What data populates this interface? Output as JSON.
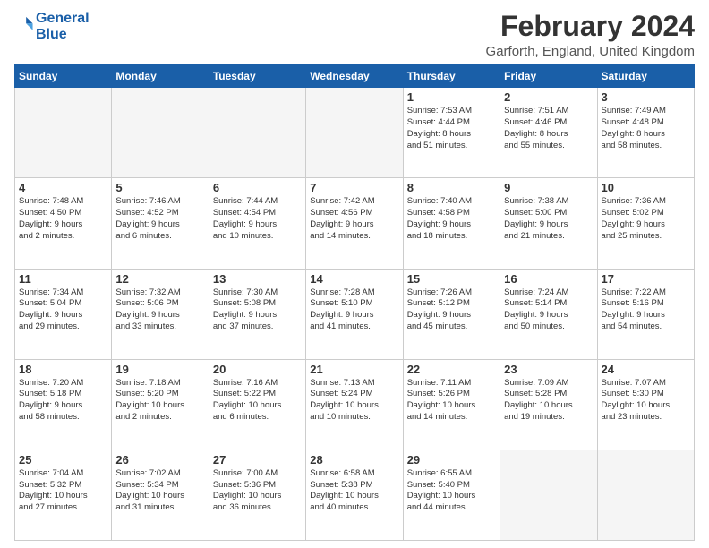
{
  "logo": {
    "line1": "General",
    "line2": "Blue"
  },
  "title": {
    "main": "February 2024",
    "sub": "Garforth, England, United Kingdom"
  },
  "days_of_week": [
    "Sunday",
    "Monday",
    "Tuesday",
    "Wednesday",
    "Thursday",
    "Friday",
    "Saturday"
  ],
  "weeks": [
    [
      {
        "day": "",
        "info": ""
      },
      {
        "day": "",
        "info": ""
      },
      {
        "day": "",
        "info": ""
      },
      {
        "day": "",
        "info": ""
      },
      {
        "day": "1",
        "info": "Sunrise: 7:53 AM\nSunset: 4:44 PM\nDaylight: 8 hours\nand 51 minutes."
      },
      {
        "day": "2",
        "info": "Sunrise: 7:51 AM\nSunset: 4:46 PM\nDaylight: 8 hours\nand 55 minutes."
      },
      {
        "day": "3",
        "info": "Sunrise: 7:49 AM\nSunset: 4:48 PM\nDaylight: 8 hours\nand 58 minutes."
      }
    ],
    [
      {
        "day": "4",
        "info": "Sunrise: 7:48 AM\nSunset: 4:50 PM\nDaylight: 9 hours\nand 2 minutes."
      },
      {
        "day": "5",
        "info": "Sunrise: 7:46 AM\nSunset: 4:52 PM\nDaylight: 9 hours\nand 6 minutes."
      },
      {
        "day": "6",
        "info": "Sunrise: 7:44 AM\nSunset: 4:54 PM\nDaylight: 9 hours\nand 10 minutes."
      },
      {
        "day": "7",
        "info": "Sunrise: 7:42 AM\nSunset: 4:56 PM\nDaylight: 9 hours\nand 14 minutes."
      },
      {
        "day": "8",
        "info": "Sunrise: 7:40 AM\nSunset: 4:58 PM\nDaylight: 9 hours\nand 18 minutes."
      },
      {
        "day": "9",
        "info": "Sunrise: 7:38 AM\nSunset: 5:00 PM\nDaylight: 9 hours\nand 21 minutes."
      },
      {
        "day": "10",
        "info": "Sunrise: 7:36 AM\nSunset: 5:02 PM\nDaylight: 9 hours\nand 25 minutes."
      }
    ],
    [
      {
        "day": "11",
        "info": "Sunrise: 7:34 AM\nSunset: 5:04 PM\nDaylight: 9 hours\nand 29 minutes."
      },
      {
        "day": "12",
        "info": "Sunrise: 7:32 AM\nSunset: 5:06 PM\nDaylight: 9 hours\nand 33 minutes."
      },
      {
        "day": "13",
        "info": "Sunrise: 7:30 AM\nSunset: 5:08 PM\nDaylight: 9 hours\nand 37 minutes."
      },
      {
        "day": "14",
        "info": "Sunrise: 7:28 AM\nSunset: 5:10 PM\nDaylight: 9 hours\nand 41 minutes."
      },
      {
        "day": "15",
        "info": "Sunrise: 7:26 AM\nSunset: 5:12 PM\nDaylight: 9 hours\nand 45 minutes."
      },
      {
        "day": "16",
        "info": "Sunrise: 7:24 AM\nSunset: 5:14 PM\nDaylight: 9 hours\nand 50 minutes."
      },
      {
        "day": "17",
        "info": "Sunrise: 7:22 AM\nSunset: 5:16 PM\nDaylight: 9 hours\nand 54 minutes."
      }
    ],
    [
      {
        "day": "18",
        "info": "Sunrise: 7:20 AM\nSunset: 5:18 PM\nDaylight: 9 hours\nand 58 minutes."
      },
      {
        "day": "19",
        "info": "Sunrise: 7:18 AM\nSunset: 5:20 PM\nDaylight: 10 hours\nand 2 minutes."
      },
      {
        "day": "20",
        "info": "Sunrise: 7:16 AM\nSunset: 5:22 PM\nDaylight: 10 hours\nand 6 minutes."
      },
      {
        "day": "21",
        "info": "Sunrise: 7:13 AM\nSunset: 5:24 PM\nDaylight: 10 hours\nand 10 minutes."
      },
      {
        "day": "22",
        "info": "Sunrise: 7:11 AM\nSunset: 5:26 PM\nDaylight: 10 hours\nand 14 minutes."
      },
      {
        "day": "23",
        "info": "Sunrise: 7:09 AM\nSunset: 5:28 PM\nDaylight: 10 hours\nand 19 minutes."
      },
      {
        "day": "24",
        "info": "Sunrise: 7:07 AM\nSunset: 5:30 PM\nDaylight: 10 hours\nand 23 minutes."
      }
    ],
    [
      {
        "day": "25",
        "info": "Sunrise: 7:04 AM\nSunset: 5:32 PM\nDaylight: 10 hours\nand 27 minutes."
      },
      {
        "day": "26",
        "info": "Sunrise: 7:02 AM\nSunset: 5:34 PM\nDaylight: 10 hours\nand 31 minutes."
      },
      {
        "day": "27",
        "info": "Sunrise: 7:00 AM\nSunset: 5:36 PM\nDaylight: 10 hours\nand 36 minutes."
      },
      {
        "day": "28",
        "info": "Sunrise: 6:58 AM\nSunset: 5:38 PM\nDaylight: 10 hours\nand 40 minutes."
      },
      {
        "day": "29",
        "info": "Sunrise: 6:55 AM\nSunset: 5:40 PM\nDaylight: 10 hours\nand 44 minutes."
      },
      {
        "day": "",
        "info": ""
      },
      {
        "day": "",
        "info": ""
      }
    ]
  ]
}
